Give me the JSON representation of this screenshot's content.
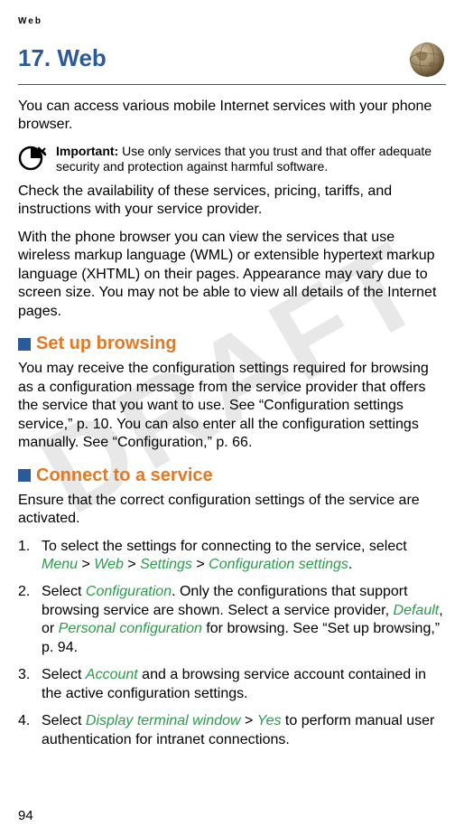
{
  "running_header": "Web",
  "watermark": "DRAFT",
  "chapter": {
    "number": "17.",
    "title": "Web",
    "icon": "globe-icon"
  },
  "intro": "You can access various mobile Internet services with your phone browser.",
  "important": {
    "label": "Important:",
    "text": " Use only services that you trust and that offer adequate security and protection against harmful software."
  },
  "availability": "Check the availability of these services, pricing, tariffs, and instructions with your service provider.",
  "browser_desc": "With the phone browser you can view the services that use wireless markup language (WML) or extensible hypertext markup language (XHTML) on their pages. Appearance may vary due to screen size. You may not be able to view all details of the Internet pages.",
  "sections": {
    "setup": {
      "title": "Set up browsing",
      "text": "You may receive the configuration settings required for browsing as a configuration message from the service provider that offers the service that you want to use. See “Configuration settings service,” p. 10. You can also enter all the configuration settings manually. See “Configuration,” p. 66."
    },
    "connect": {
      "title": "Connect to a service",
      "intro": "Ensure that the correct configuration settings of the service are activated.",
      "steps": [
        {
          "pre": "To select the settings for connecting to the service, select ",
          "links": [
            "Menu",
            "Web",
            "Settings",
            "Configuration settings"
          ],
          "sep": " > ",
          "post": "."
        },
        {
          "pre": "Select ",
          "link1": "Configuration",
          "mid1": ". Only the configurations that support browsing service are shown. Select a service provider, ",
          "link2": "Default",
          "mid2": ", or ",
          "link3": "Personal configuration",
          "post": " for browsing. See “Set up browsing,” p. 94."
        },
        {
          "pre": "Select ",
          "link1": "Account",
          "post": " and a browsing service account contained in the active configuration settings."
        },
        {
          "pre": "Select ",
          "link1": "Display terminal window",
          "mid1": " > ",
          "link2": "Yes",
          "post": " to perform manual user authentication for intranet connections."
        }
      ]
    }
  },
  "page_number": "94"
}
